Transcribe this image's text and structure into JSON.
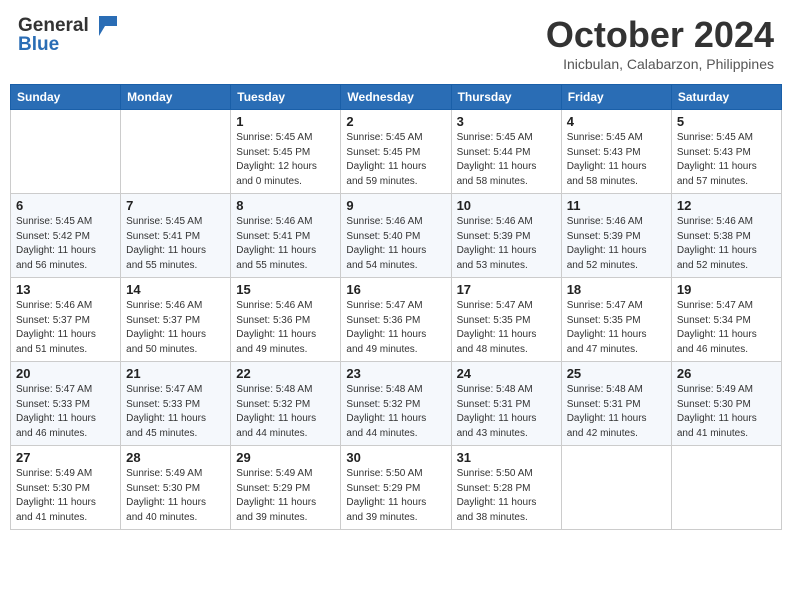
{
  "header": {
    "logo_line1": "General",
    "logo_line2": "Blue",
    "month": "October 2024",
    "location": "Inicbulan, Calabarzon, Philippines"
  },
  "weekdays": [
    "Sunday",
    "Monday",
    "Tuesday",
    "Wednesday",
    "Thursday",
    "Friday",
    "Saturday"
  ],
  "weeks": [
    [
      {
        "day": "",
        "sunrise": "",
        "sunset": "",
        "daylight": ""
      },
      {
        "day": "",
        "sunrise": "",
        "sunset": "",
        "daylight": ""
      },
      {
        "day": "1",
        "sunrise": "Sunrise: 5:45 AM",
        "sunset": "Sunset: 5:45 PM",
        "daylight": "Daylight: 12 hours and 0 minutes."
      },
      {
        "day": "2",
        "sunrise": "Sunrise: 5:45 AM",
        "sunset": "Sunset: 5:45 PM",
        "daylight": "Daylight: 11 hours and 59 minutes."
      },
      {
        "day": "3",
        "sunrise": "Sunrise: 5:45 AM",
        "sunset": "Sunset: 5:44 PM",
        "daylight": "Daylight: 11 hours and 58 minutes."
      },
      {
        "day": "4",
        "sunrise": "Sunrise: 5:45 AM",
        "sunset": "Sunset: 5:43 PM",
        "daylight": "Daylight: 11 hours and 58 minutes."
      },
      {
        "day": "5",
        "sunrise": "Sunrise: 5:45 AM",
        "sunset": "Sunset: 5:43 PM",
        "daylight": "Daylight: 11 hours and 57 minutes."
      }
    ],
    [
      {
        "day": "6",
        "sunrise": "Sunrise: 5:45 AM",
        "sunset": "Sunset: 5:42 PM",
        "daylight": "Daylight: 11 hours and 56 minutes."
      },
      {
        "day": "7",
        "sunrise": "Sunrise: 5:45 AM",
        "sunset": "Sunset: 5:41 PM",
        "daylight": "Daylight: 11 hours and 55 minutes."
      },
      {
        "day": "8",
        "sunrise": "Sunrise: 5:46 AM",
        "sunset": "Sunset: 5:41 PM",
        "daylight": "Daylight: 11 hours and 55 minutes."
      },
      {
        "day": "9",
        "sunrise": "Sunrise: 5:46 AM",
        "sunset": "Sunset: 5:40 PM",
        "daylight": "Daylight: 11 hours and 54 minutes."
      },
      {
        "day": "10",
        "sunrise": "Sunrise: 5:46 AM",
        "sunset": "Sunset: 5:39 PM",
        "daylight": "Daylight: 11 hours and 53 minutes."
      },
      {
        "day": "11",
        "sunrise": "Sunrise: 5:46 AM",
        "sunset": "Sunset: 5:39 PM",
        "daylight": "Daylight: 11 hours and 52 minutes."
      },
      {
        "day": "12",
        "sunrise": "Sunrise: 5:46 AM",
        "sunset": "Sunset: 5:38 PM",
        "daylight": "Daylight: 11 hours and 52 minutes."
      }
    ],
    [
      {
        "day": "13",
        "sunrise": "Sunrise: 5:46 AM",
        "sunset": "Sunset: 5:37 PM",
        "daylight": "Daylight: 11 hours and 51 minutes."
      },
      {
        "day": "14",
        "sunrise": "Sunrise: 5:46 AM",
        "sunset": "Sunset: 5:37 PM",
        "daylight": "Daylight: 11 hours and 50 minutes."
      },
      {
        "day": "15",
        "sunrise": "Sunrise: 5:46 AM",
        "sunset": "Sunset: 5:36 PM",
        "daylight": "Daylight: 11 hours and 49 minutes."
      },
      {
        "day": "16",
        "sunrise": "Sunrise: 5:47 AM",
        "sunset": "Sunset: 5:36 PM",
        "daylight": "Daylight: 11 hours and 49 minutes."
      },
      {
        "day": "17",
        "sunrise": "Sunrise: 5:47 AM",
        "sunset": "Sunset: 5:35 PM",
        "daylight": "Daylight: 11 hours and 48 minutes."
      },
      {
        "day": "18",
        "sunrise": "Sunrise: 5:47 AM",
        "sunset": "Sunset: 5:35 PM",
        "daylight": "Daylight: 11 hours and 47 minutes."
      },
      {
        "day": "19",
        "sunrise": "Sunrise: 5:47 AM",
        "sunset": "Sunset: 5:34 PM",
        "daylight": "Daylight: 11 hours and 46 minutes."
      }
    ],
    [
      {
        "day": "20",
        "sunrise": "Sunrise: 5:47 AM",
        "sunset": "Sunset: 5:33 PM",
        "daylight": "Daylight: 11 hours and 46 minutes."
      },
      {
        "day": "21",
        "sunrise": "Sunrise: 5:47 AM",
        "sunset": "Sunset: 5:33 PM",
        "daylight": "Daylight: 11 hours and 45 minutes."
      },
      {
        "day": "22",
        "sunrise": "Sunrise: 5:48 AM",
        "sunset": "Sunset: 5:32 PM",
        "daylight": "Daylight: 11 hours and 44 minutes."
      },
      {
        "day": "23",
        "sunrise": "Sunrise: 5:48 AM",
        "sunset": "Sunset: 5:32 PM",
        "daylight": "Daylight: 11 hours and 44 minutes."
      },
      {
        "day": "24",
        "sunrise": "Sunrise: 5:48 AM",
        "sunset": "Sunset: 5:31 PM",
        "daylight": "Daylight: 11 hours and 43 minutes."
      },
      {
        "day": "25",
        "sunrise": "Sunrise: 5:48 AM",
        "sunset": "Sunset: 5:31 PM",
        "daylight": "Daylight: 11 hours and 42 minutes."
      },
      {
        "day": "26",
        "sunrise": "Sunrise: 5:49 AM",
        "sunset": "Sunset: 5:30 PM",
        "daylight": "Daylight: 11 hours and 41 minutes."
      }
    ],
    [
      {
        "day": "27",
        "sunrise": "Sunrise: 5:49 AM",
        "sunset": "Sunset: 5:30 PM",
        "daylight": "Daylight: 11 hours and 41 minutes."
      },
      {
        "day": "28",
        "sunrise": "Sunrise: 5:49 AM",
        "sunset": "Sunset: 5:30 PM",
        "daylight": "Daylight: 11 hours and 40 minutes."
      },
      {
        "day": "29",
        "sunrise": "Sunrise: 5:49 AM",
        "sunset": "Sunset: 5:29 PM",
        "daylight": "Daylight: 11 hours and 39 minutes."
      },
      {
        "day": "30",
        "sunrise": "Sunrise: 5:50 AM",
        "sunset": "Sunset: 5:29 PM",
        "daylight": "Daylight: 11 hours and 39 minutes."
      },
      {
        "day": "31",
        "sunrise": "Sunrise: 5:50 AM",
        "sunset": "Sunset: 5:28 PM",
        "daylight": "Daylight: 11 hours and 38 minutes."
      },
      {
        "day": "",
        "sunrise": "",
        "sunset": "",
        "daylight": ""
      },
      {
        "day": "",
        "sunrise": "",
        "sunset": "",
        "daylight": ""
      }
    ]
  ]
}
